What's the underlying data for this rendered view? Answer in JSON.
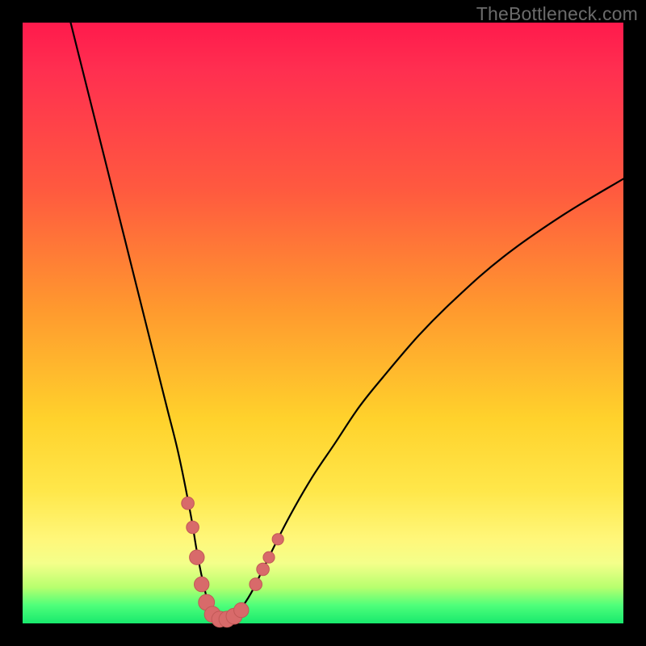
{
  "domain": "Chart",
  "watermark": "TheBottleneck.com",
  "colors": {
    "frame": "#000000",
    "curve_stroke": "#000000",
    "marker_fill": "#d86a6a",
    "marker_stroke": "#c15856",
    "gradient_stops": [
      "#ff1a4c",
      "#ff5a3f",
      "#ff9a2e",
      "#ffd22c",
      "#fff77a",
      "#4eff7a",
      "#18e96d"
    ]
  },
  "chart_data": {
    "type": "line",
    "title": "",
    "xlabel": "",
    "ylabel": "",
    "xlim": [
      0,
      100
    ],
    "ylim": [
      0,
      100
    ],
    "annotations": [
      "TheBottleneck.com"
    ],
    "series": [
      {
        "name": "bottleneck-curve",
        "x": [
          8,
          10,
          12,
          14,
          16,
          18,
          20,
          22,
          24,
          26,
          28,
          29,
          30,
          31,
          32,
          33,
          34,
          35,
          36,
          38,
          40,
          44,
          48,
          52,
          56,
          60,
          66,
          72,
          80,
          90,
          100
        ],
        "y": [
          100,
          92,
          84,
          76,
          68,
          60,
          52,
          44,
          36,
          28,
          18,
          12,
          7,
          3,
          1,
          0.5,
          0.5,
          1,
          2,
          5,
          9,
          17,
          24,
          30,
          36,
          41,
          48,
          54,
          61,
          68,
          74
        ]
      }
    ],
    "markers": [
      {
        "x": 27.5,
        "y": 20,
        "r": 1.1
      },
      {
        "x": 28.3,
        "y": 16,
        "r": 1.1
      },
      {
        "x": 29.0,
        "y": 11,
        "r": 1.3
      },
      {
        "x": 29.8,
        "y": 6.5,
        "r": 1.3
      },
      {
        "x": 30.6,
        "y": 3.5,
        "r": 1.4
      },
      {
        "x": 31.6,
        "y": 1.5,
        "r": 1.4
      },
      {
        "x": 32.8,
        "y": 0.7,
        "r": 1.4
      },
      {
        "x": 34.0,
        "y": 0.7,
        "r": 1.4
      },
      {
        "x": 35.2,
        "y": 1.2,
        "r": 1.4
      },
      {
        "x": 36.4,
        "y": 2.2,
        "r": 1.3
      },
      {
        "x": 38.8,
        "y": 6.5,
        "r": 1.1
      },
      {
        "x": 40.0,
        "y": 9.0,
        "r": 1.1
      },
      {
        "x": 41.0,
        "y": 11.0,
        "r": 1.0
      },
      {
        "x": 42.5,
        "y": 14.0,
        "r": 1.0
      }
    ]
  }
}
